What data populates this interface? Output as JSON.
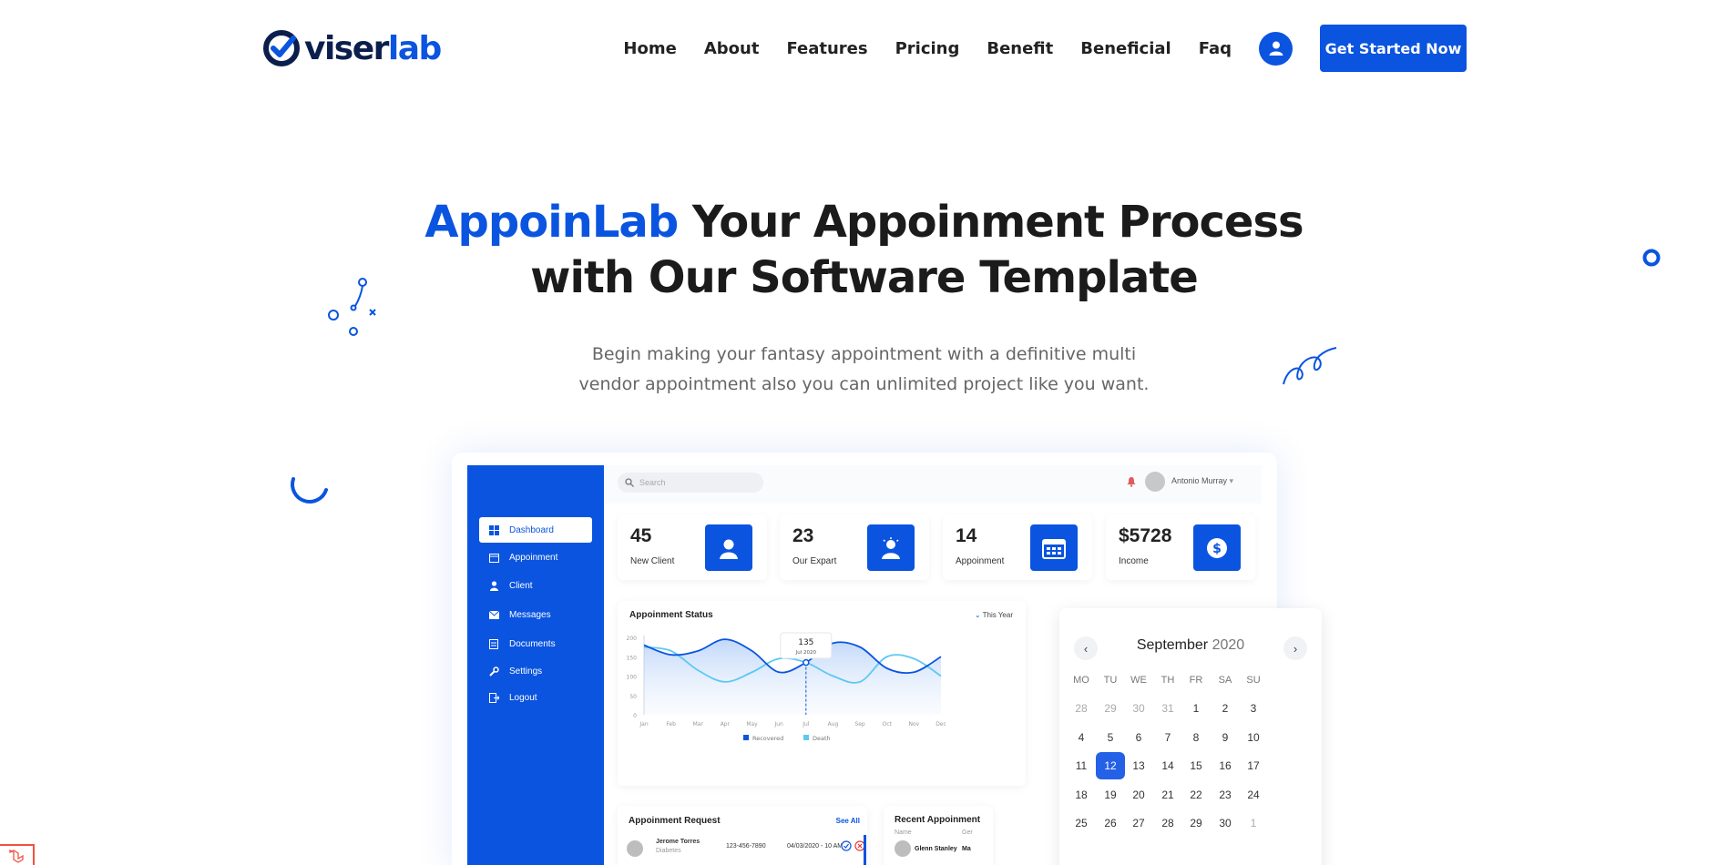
{
  "nav": {
    "logo": {
      "text_a": "viser",
      "text_b": "lab"
    },
    "items": [
      "Home",
      "About",
      "Features",
      "Pricing",
      "Benefit",
      "Beneficial",
      "Faq"
    ],
    "cta": "Get Started Now"
  },
  "hero": {
    "title_accent": "AppoinLab",
    "title_rest_1": " Your Appoinment Process",
    "title_line_2": "with Our Software Template",
    "subtitle_line_1": "Begin making your fantasy appointment with a definitive multi",
    "subtitle_line_2": "vendor appointment also you can unlimited project like you want."
  },
  "dashboard": {
    "sidebar": [
      "Dashboard",
      "Appoinment",
      "Client",
      "Messages",
      "Documents",
      "Settings",
      "Logout"
    ],
    "search_placeholder": "Search",
    "user_name": "Antonio Murray",
    "stats": [
      {
        "value": "45",
        "label": "New Client",
        "icon": "user-icon"
      },
      {
        "value": "23",
        "label": "Our Expart",
        "icon": "expert-icon"
      },
      {
        "value": "14",
        "label": "Appoinment",
        "icon": "calendar-icon"
      },
      {
        "value": "$5728",
        "label": "Income",
        "icon": "dollar-icon"
      }
    ],
    "chart_panel": {
      "title": "Appoinment Status",
      "filter": "This Year",
      "tooltip_value": "135",
      "tooltip_date": "Jul 2020"
    },
    "appointment_request": {
      "title": "Appoinment Request",
      "see_all": "See All",
      "rows": [
        {
          "name": "Jerome Torres",
          "sub": "Diabetes",
          "phone": "123-456-7890",
          "date": "04/03/2020 - 10 AM"
        }
      ]
    },
    "recent_appointment": {
      "title": "Recent Appoinment",
      "col_name": "Name",
      "col_gender": "Ger",
      "rows": [
        {
          "name": "Glenn Stanley",
          "gender": "Ma"
        }
      ]
    },
    "calendar": {
      "month": "September",
      "year": "2020",
      "weekdays": [
        "MO",
        "TU",
        "WE",
        "TH",
        "FR",
        "SA",
        "SU"
      ],
      "weeks": [
        [
          "28",
          "29",
          "30",
          "31",
          "1",
          "2",
          "3"
        ],
        [
          "4",
          "5",
          "6",
          "7",
          "8",
          "9",
          "10"
        ],
        [
          "11",
          "12",
          "13",
          "14",
          "15",
          "16",
          "17"
        ],
        [
          "18",
          "19",
          "20",
          "21",
          "22",
          "23",
          "24"
        ],
        [
          "25",
          "26",
          "27",
          "28",
          "29",
          "30",
          "1"
        ]
      ],
      "selected": "12"
    }
  },
  "chart_data": {
    "type": "line",
    "title": "Appoinment Status",
    "categories": [
      "Jan",
      "Feb",
      "Mar",
      "Apr",
      "May",
      "Jun",
      "Jul",
      "Aug",
      "Sep",
      "Oct",
      "Nov",
      "Dec"
    ],
    "series": [
      {
        "name": "Recovered",
        "color": "#0a54e0",
        "values": [
          180,
          155,
          165,
          195,
          165,
          110,
          135,
          185,
          175,
          120,
          110,
          150
        ]
      },
      {
        "name": "Death",
        "color": "#5ec8f2",
        "values": [
          175,
          165,
          115,
          85,
          110,
          145,
          135,
          100,
          85,
          150,
          145,
          100
        ]
      }
    ],
    "yticks": [
      "0",
      "50",
      "100",
      "150",
      "200"
    ],
    "ylim": [
      0,
      200
    ],
    "legend": "bottom-center"
  },
  "colors": {
    "accent": "#0a54e0",
    "death": "#5ec8f2",
    "text": "#1b1b1b"
  }
}
